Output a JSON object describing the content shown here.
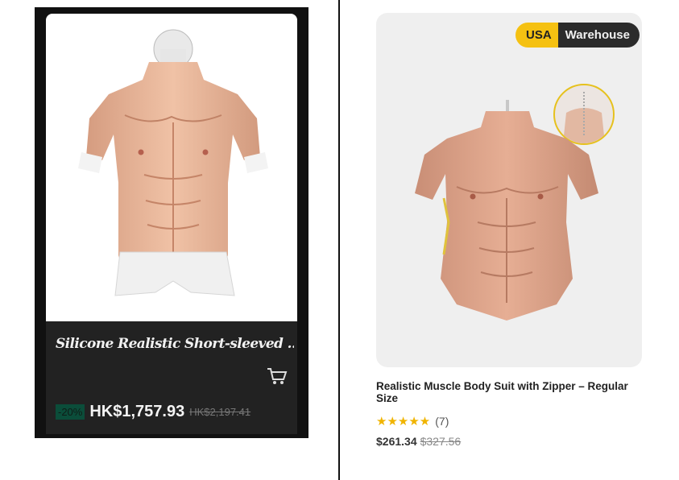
{
  "left_product": {
    "title": "Silicone Realistic Short-sleeved ...",
    "discount": "-20%",
    "price": "HK$1,757.93",
    "original_price": "HK$2,197.41",
    "cart_icon": "shopping-cart-icon"
  },
  "right_product": {
    "badge": {
      "left": "USA",
      "right": "Warehouse"
    },
    "title": "Realistic Muscle Body Suit with Zipper – Regular Size",
    "rating": {
      "stars": "★★★★★",
      "count": "(7)",
      "value": 5
    },
    "price": "$261.34",
    "original_price": "$327.56"
  },
  "colors": {
    "badge_yellow": "#f5c112",
    "badge_dark": "#2b2b2b",
    "star": "#f0b400",
    "discount_bg": "#0b4d3a"
  }
}
